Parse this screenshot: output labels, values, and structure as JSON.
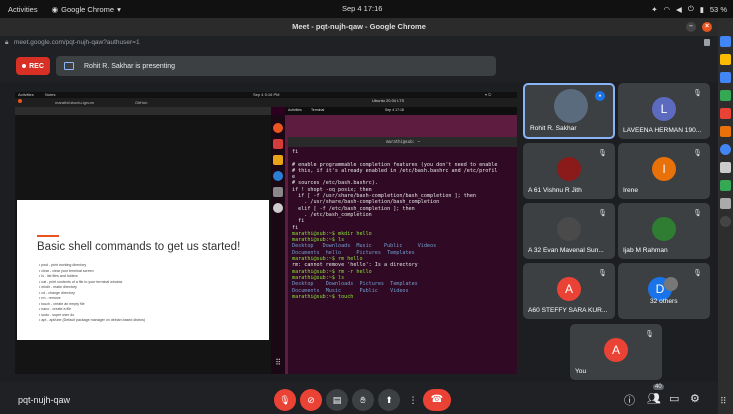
{
  "topbar": {
    "activities": "Activities",
    "app": "Google Chrome",
    "clock": "Sep 4  17:16",
    "battery": "53 %"
  },
  "window": {
    "title": "Meet - pqt-nujh-qaw - Google Chrome",
    "url": "meet.google.com/pqt-nujh-qaw?authuser=1"
  },
  "presenting": {
    "rec_label": "REC",
    "presenter_text": "Rohit R. Sakhar is presenting"
  },
  "inner": {
    "activities": "Activities",
    "notes": "Notes",
    "clock": "Sep 4  5:16 PM",
    "tab": "marathi/ubuntu-ignum",
    "tab2": "GitHub",
    "vm_title": "Ubuntu 20.04 LTS",
    "terminal_app": "Terminal",
    "ubuntu_clock": "Sep 4  17:18"
  },
  "slide": {
    "title": "Basic shell commands to get us started!",
    "items": [
      "pwd - print working directory",
      "clear - clear your terminal screen",
      "ls - list files and folders",
      "cat - print contents of a file to your terminal window",
      "mkdir - make directory",
      "cd - change directory",
      "rm - remove",
      "touch - create an empty file",
      "nano - create a file",
      "sudo - super user do",
      "apt - apt/ube (Default package manager on debian based distros)"
    ]
  },
  "terminal": {
    "header": "marathi@sub: ~",
    "lines": [
      {
        "t": "fi",
        "c": ""
      },
      {
        "t": "",
        "c": ""
      },
      {
        "t": "# enable programmable completion features (you don't need to enable",
        "c": ""
      },
      {
        "t": "# this, if it's already enabled in /etc/bash.bashrc and /etc/profil",
        "c": ""
      },
      {
        "t": "e",
        "c": ""
      },
      {
        "t": "# sources /etc/bash.bashrc).",
        "c": ""
      },
      {
        "t": "if ! shopt -oq posix; then",
        "c": ""
      },
      {
        "t": "  if [ -f /usr/share/bash-completion/bash_completion ]; then",
        "c": ""
      },
      {
        "t": "    . /usr/share/bash-completion/bash_completion",
        "c": ""
      },
      {
        "t": "  elif [ -f /etc/bash_completion ]; then",
        "c": ""
      },
      {
        "t": "    . /etc/bash_completion",
        "c": ""
      },
      {
        "t": "  fi",
        "c": ""
      },
      {
        "t": "fi",
        "c": ""
      },
      {
        "t": "marathi@sub:~$ mkdir hello",
        "c": "pr"
      },
      {
        "t": "marathi@sub:~$ ls",
        "c": "pr"
      },
      {
        "t": "Desktop   Downloads  Music    Public     Videos",
        "c": "bl"
      },
      {
        "t": "Documents  hello     Pictures  Templates",
        "c": "bl"
      },
      {
        "t": "marathi@sub:~$ rm hello",
        "c": "pr"
      },
      {
        "t": "rm: cannot remove 'hello': Is a directory",
        "c": ""
      },
      {
        "t": "marathi@sub:~$ rm -r hello",
        "c": "pr"
      },
      {
        "t": "marathi@sub:~$ ls",
        "c": "pr"
      },
      {
        "t": "Desktop    Downloads  Pictures  Templates",
        "c": "bl"
      },
      {
        "t": "Documents  Music      Public    Videos",
        "c": "bl"
      },
      {
        "t": "marathi@sub:~$ touch",
        "c": "pr"
      }
    ]
  },
  "participants": [
    {
      "name": "Rohit R. Sakhar",
      "avatar": "",
      "color": "#5a6b7d",
      "active": true
    },
    {
      "name": "LAVEENA HERMAN 190...",
      "avatar": "L",
      "color": "#5c6bc0"
    },
    {
      "name": "A 61 Vishnu R Jith",
      "avatar": "",
      "color": "#8b1a1a"
    },
    {
      "name": "Irene",
      "avatar": "I",
      "color": "#e8710a"
    },
    {
      "name": "A 32 Evan Mavenal Sun...",
      "avatar": "",
      "color": "#4a4a4a"
    },
    {
      "name": "Ijab M Rahman",
      "avatar": "",
      "color": "#2e7d32"
    },
    {
      "name": "A60 STEFFY SARA KUR...",
      "avatar": "A",
      "color": "#ea4335"
    },
    {
      "name": "32 others",
      "avatar": "D",
      "color": "#1a73e8"
    },
    {
      "name": "You",
      "avatar": "A",
      "color": "#ea4335"
    }
  ],
  "bottom": {
    "meeting_code": "pqt-nujh-qaw",
    "participant_count": "40"
  }
}
